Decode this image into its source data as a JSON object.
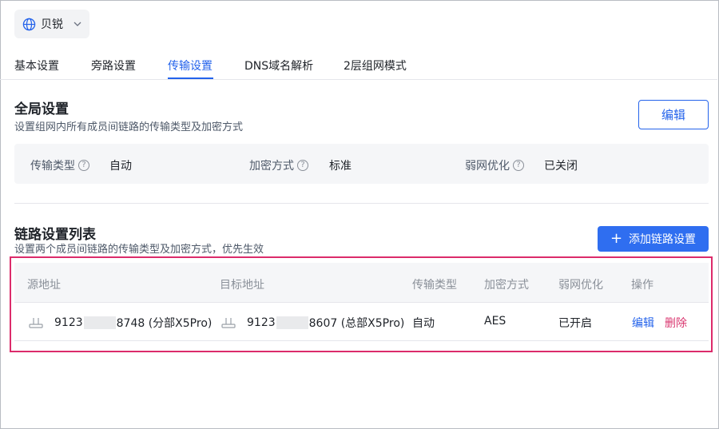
{
  "org": {
    "name": "贝锐",
    "icon": "globe-icon"
  },
  "tabs": [
    {
      "label": "基本设置"
    },
    {
      "label": "旁路设置"
    },
    {
      "label": "传输设置"
    },
    {
      "label": "DNS域名解析"
    },
    {
      "label": "2层组网模式"
    }
  ],
  "active_tab": "传输设置",
  "global": {
    "title": "全局设置",
    "desc": "设置组网内所有成员间链路的传输类型及加密方式",
    "edit_label": "编辑",
    "settings": [
      {
        "label": "传输类型",
        "value": "自动"
      },
      {
        "label": "加密方式",
        "value": "标准"
      },
      {
        "label": "弱网优化",
        "value": "已关闭"
      }
    ]
  },
  "links": {
    "title": "链路设置列表",
    "desc": "设置两个成员间链路的传输类型及加密方式，优先生效",
    "add_label": "添加链路设置",
    "columns": [
      "源地址",
      "目标地址",
      "传输类型",
      "加密方式",
      "弱网优化",
      "操作"
    ],
    "rows": [
      {
        "src_prefix": "9123",
        "src_suffix": "8748 (分部X5Pro)",
        "dst_prefix": "9123",
        "dst_suffix": "8607 (总部X5Pro)",
        "transport": "自动",
        "encryption": "AES",
        "weak_net": "已开启",
        "edit": "编辑",
        "delete": "删除"
      }
    ]
  },
  "colors": {
    "accent": "#2463eb",
    "primary_button": "#2f6ef0",
    "danger": "#d9366f",
    "highlight_border": "#dc2b6b"
  }
}
